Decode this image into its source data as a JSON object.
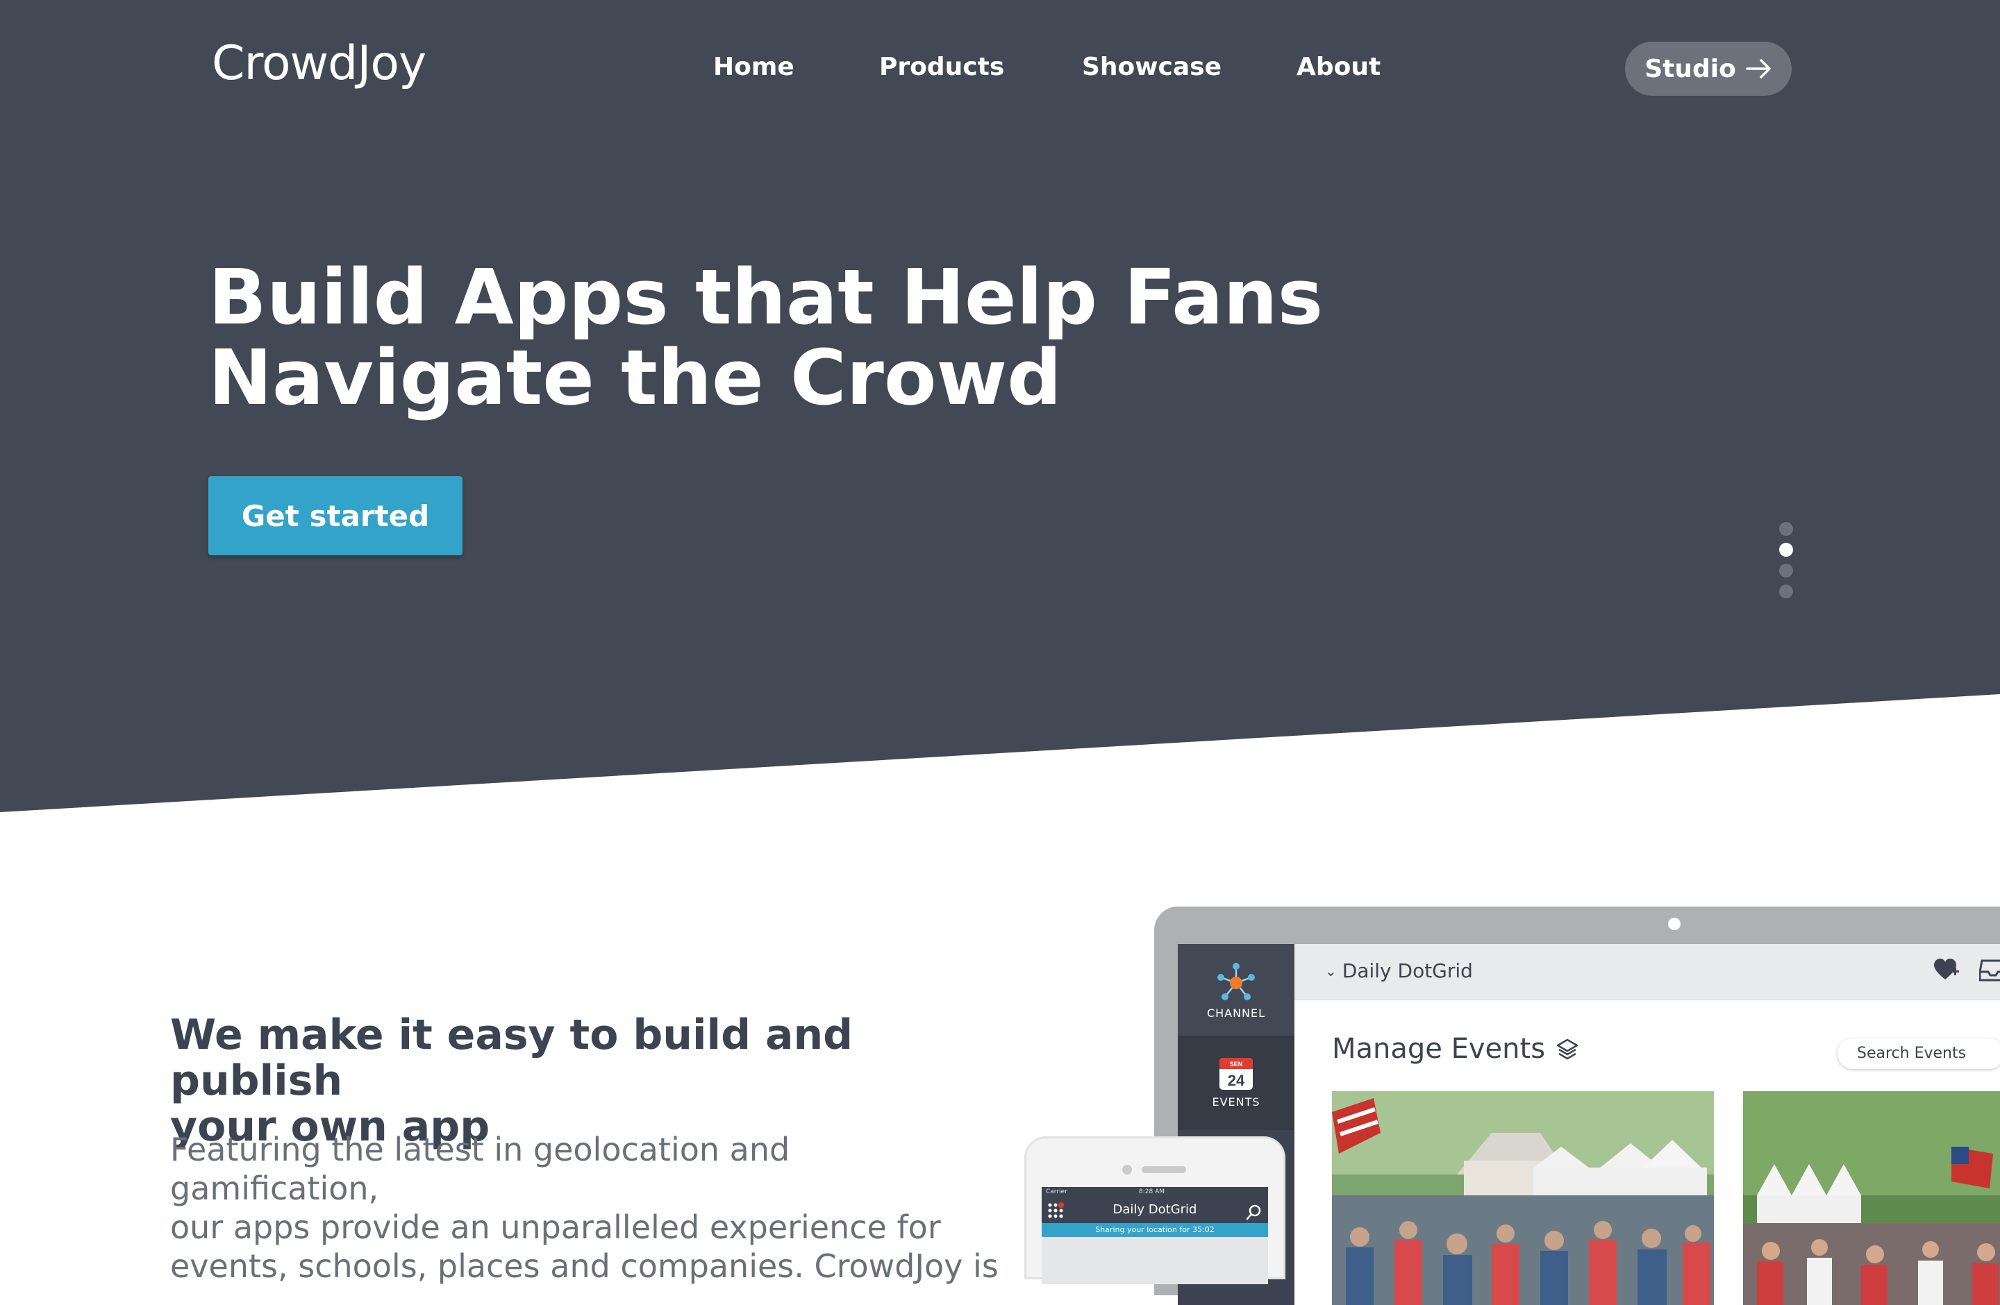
{
  "brand": {
    "name": "CrowdJoy"
  },
  "nav": {
    "items": [
      {
        "label": "Home"
      },
      {
        "label": "Products"
      },
      {
        "label": "Showcase"
      },
      {
        "label": "About"
      }
    ],
    "studio_label": "Studio"
  },
  "hero": {
    "headline_line1": "Build Apps that Help Fans",
    "headline_line2": "Navigate the Crowd",
    "cta_label": "Get started",
    "slides": {
      "count": 4,
      "active_index": 1
    }
  },
  "feature": {
    "title_line1": "We make it easy to build and publish",
    "title_line2": "your own app",
    "text_line1": "Featuring the latest in geolocation and gamification,",
    "text_line2": "our apps provide an unparalleled experience for",
    "text_line3": "events, schools, places and companies. CrowdJoy is"
  },
  "laptop_app": {
    "sidebar": {
      "channel_label": "CHANNEL",
      "events_label": "EVENTS",
      "calendar_month": "SEN",
      "calendar_day": "24"
    },
    "channel_name": "Daily DotGrid",
    "page_title": "Manage Events",
    "search_placeholder": "Search Events"
  },
  "phone_app": {
    "carrier": "Carrier",
    "time": "8:28 AM",
    "title": "Daily DotGrid",
    "banner": "Sharing your location for 35:02"
  },
  "colors": {
    "hero_bg": "#424854",
    "accent": "#33a3c9",
    "studio_bg": "#6c717b",
    "heading_text": "#3d4451",
    "body_text": "#6a6f78"
  },
  "icons": {
    "studio_arrow": "arrow-right-icon",
    "channel": "star-network-icon",
    "events": "calendar-icon",
    "layers": "layers-icon",
    "heart": "heart-plus-icon",
    "inbox": "inbox-icon",
    "chevron": "chevron-down-icon",
    "grid": "grid-icon",
    "search": "search-icon"
  }
}
